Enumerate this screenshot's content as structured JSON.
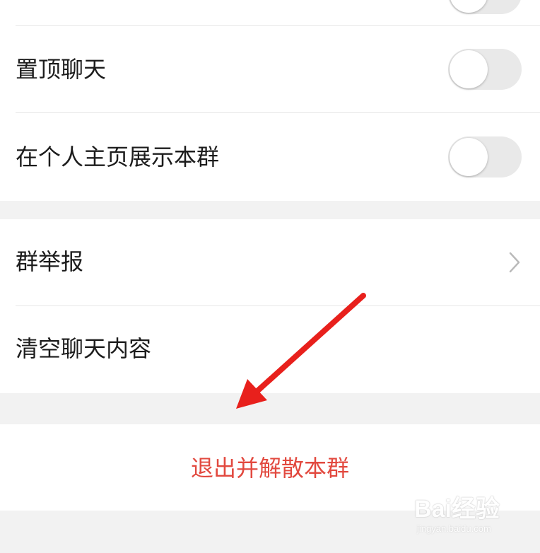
{
  "settings": {
    "pin_chat": {
      "label": "置顶聊天",
      "enabled": false
    },
    "show_on_profile": {
      "label": "在个人主页展示本群",
      "enabled": false
    },
    "report_group": {
      "label": "群举报"
    },
    "clear_history": {
      "label": "清空聊天内容"
    },
    "exit_dissolve": {
      "label": "退出并解散本群",
      "color": "#e2493f"
    }
  },
  "watermark": {
    "brand": "Bai经验",
    "url": "jingyan.baidu.com"
  },
  "colors": {
    "background": "#f2f2f2",
    "card": "#ffffff",
    "danger": "#e2493f",
    "annotation_arrow": "#e8201c"
  }
}
